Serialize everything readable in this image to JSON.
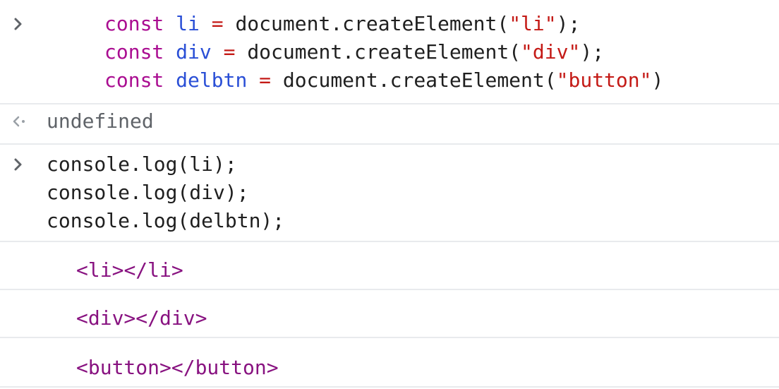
{
  "entries": {
    "input1": {
      "line1": {
        "kw": "const",
        "name": "li",
        "op": "=",
        "call": "document.createElement(",
        "arg": "\"li\"",
        "end": ");"
      },
      "line2": {
        "kw": "const",
        "name": "div",
        "op": "=",
        "call": "document.createElement(",
        "arg": "\"div\"",
        "end": ");"
      },
      "line3": {
        "kw": "const",
        "name": "delbtn",
        "op": "=",
        "call": "document.createElement(",
        "arg": "\"button\"",
        "end": ")"
      }
    },
    "result1": {
      "value": "undefined"
    },
    "input2": {
      "lines": [
        "console.log(li);",
        "console.log(div);",
        "console.log(delbtn);"
      ]
    },
    "logs": [
      {
        "open": "<li>",
        "close": "</li>"
      },
      {
        "open": "<div>",
        "close": "</div>"
      },
      {
        "open": "<button>",
        "close": "</button>"
      }
    ]
  },
  "icons": {
    "input_prompt": "chevron-right-icon",
    "result_prompt": "result-arrow-icon"
  },
  "colors": {
    "keyword": "#aa0d91",
    "identifier": "#1c00cf",
    "string": "#c41a16",
    "tag": "#881280",
    "divider": "#e8eaed"
  }
}
